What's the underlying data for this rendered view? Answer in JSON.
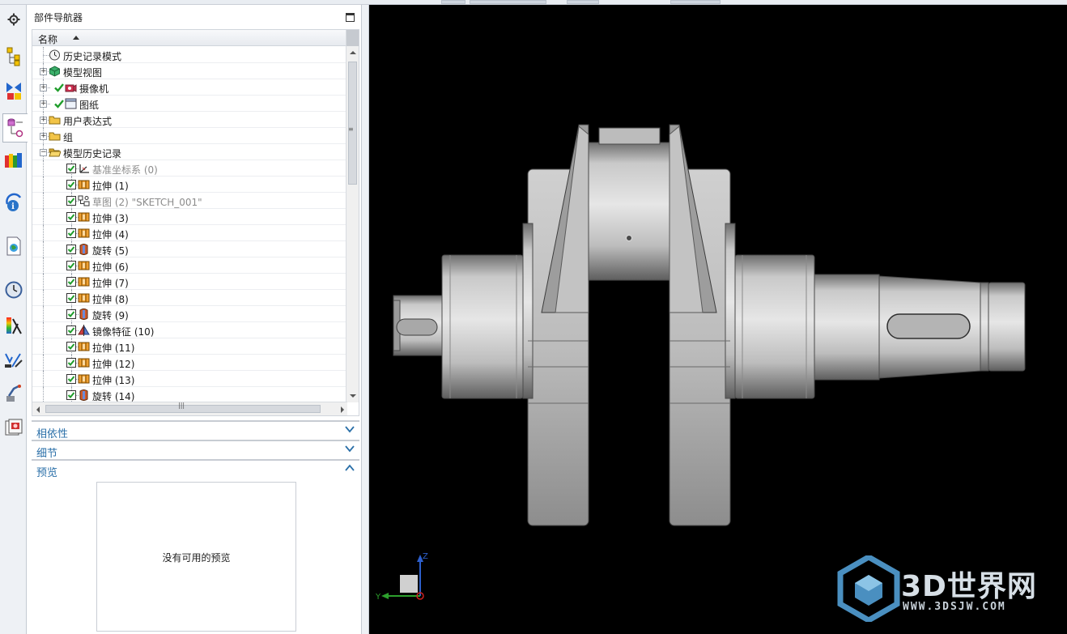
{
  "navigator": {
    "title": "部件导航器",
    "column_name": "名称",
    "tree": [
      {
        "label": "历史记录模式",
        "icon": "clock-icon",
        "level": 0,
        "expander": "",
        "checked": null,
        "dim": false
      },
      {
        "label": "模型视图",
        "icon": "model-views-icon",
        "level": 0,
        "expander": "+",
        "checked": null,
        "dim": false
      },
      {
        "label": "摄像机",
        "icon": "camera-icon",
        "level": 0,
        "expander": "+",
        "checked": "tick",
        "dim": false
      },
      {
        "label": "图纸",
        "icon": "drawing-sheet-icon",
        "level": 0,
        "expander": "+",
        "checked": "tick",
        "dim": false
      },
      {
        "label": "用户表达式",
        "icon": "folder-icon",
        "level": 0,
        "expander": "+",
        "checked": null,
        "dim": false
      },
      {
        "label": "组",
        "icon": "folder-icon",
        "level": 0,
        "expander": "+",
        "checked": null,
        "dim": false
      },
      {
        "label": "模型历史记录",
        "icon": "folder-open-icon",
        "level": 0,
        "expander": "-",
        "checked": null,
        "dim": false
      },
      {
        "label": "基准坐标系 (0)",
        "icon": "datum-csys-icon",
        "level": 1,
        "expander": "",
        "checked": "box",
        "dim": true
      },
      {
        "label": "拉伸 (1)",
        "icon": "extrude-icon",
        "level": 1,
        "expander": "",
        "checked": "box",
        "dim": false
      },
      {
        "label": "草图 (2) \"SKETCH_001\"",
        "icon": "sketch-icon",
        "level": 1,
        "expander": "",
        "checked": "box",
        "dim": true
      },
      {
        "label": "拉伸 (3)",
        "icon": "extrude-icon",
        "level": 1,
        "expander": "",
        "checked": "box",
        "dim": false
      },
      {
        "label": "拉伸 (4)",
        "icon": "extrude-icon",
        "level": 1,
        "expander": "",
        "checked": "box",
        "dim": false
      },
      {
        "label": "旋转 (5)",
        "icon": "revolve-icon",
        "level": 1,
        "expander": "",
        "checked": "box",
        "dim": false
      },
      {
        "label": "拉伸 (6)",
        "icon": "extrude-icon",
        "level": 1,
        "expander": "",
        "checked": "box",
        "dim": false
      },
      {
        "label": "拉伸 (7)",
        "icon": "extrude-icon",
        "level": 1,
        "expander": "",
        "checked": "box",
        "dim": false
      },
      {
        "label": "拉伸 (8)",
        "icon": "extrude-icon",
        "level": 1,
        "expander": "",
        "checked": "box",
        "dim": false
      },
      {
        "label": "旋转 (9)",
        "icon": "revolve-icon",
        "level": 1,
        "expander": "",
        "checked": "box",
        "dim": false
      },
      {
        "label": "镜像特征 (10)",
        "icon": "mirror-feature-icon",
        "level": 1,
        "expander": "",
        "checked": "box",
        "dim": false
      },
      {
        "label": "拉伸 (11)",
        "icon": "extrude-icon",
        "level": 1,
        "expander": "",
        "checked": "box",
        "dim": false
      },
      {
        "label": "拉伸 (12)",
        "icon": "extrude-icon",
        "level": 1,
        "expander": "",
        "checked": "box",
        "dim": false
      },
      {
        "label": "拉伸 (13)",
        "icon": "extrude-icon",
        "level": 1,
        "expander": "",
        "checked": "box",
        "dim": false
      },
      {
        "label": "旋转 (14)",
        "icon": "revolve-icon",
        "level": 1,
        "expander": "",
        "checked": "box",
        "dim": false
      }
    ],
    "sections": {
      "dependencies": "相依性",
      "details": "细节",
      "preview": "预览"
    },
    "preview_empty": "没有可用的预览"
  },
  "resource_bar": [
    "settings-gear-icon",
    "assembly-navigator-icon",
    "constraint-navigator-icon",
    "part-navigator-icon",
    "reuse-library-icon",
    "hd3d-tools-icon",
    "web-browser-icon",
    "history-icon",
    "system-materials-icon",
    "process-studio-icon",
    "manufacturing-wizard-icon",
    "roles-icon"
  ],
  "viewport": {
    "background": "#000000",
    "triad": {
      "z": "Z",
      "y": "Y"
    },
    "watermark": {
      "brand": "3D世界网",
      "url": "WWW.3DSJW.COM"
    }
  },
  "colors": {
    "section_title": "#2a6fa8",
    "check_green": "#1f9d2b"
  }
}
